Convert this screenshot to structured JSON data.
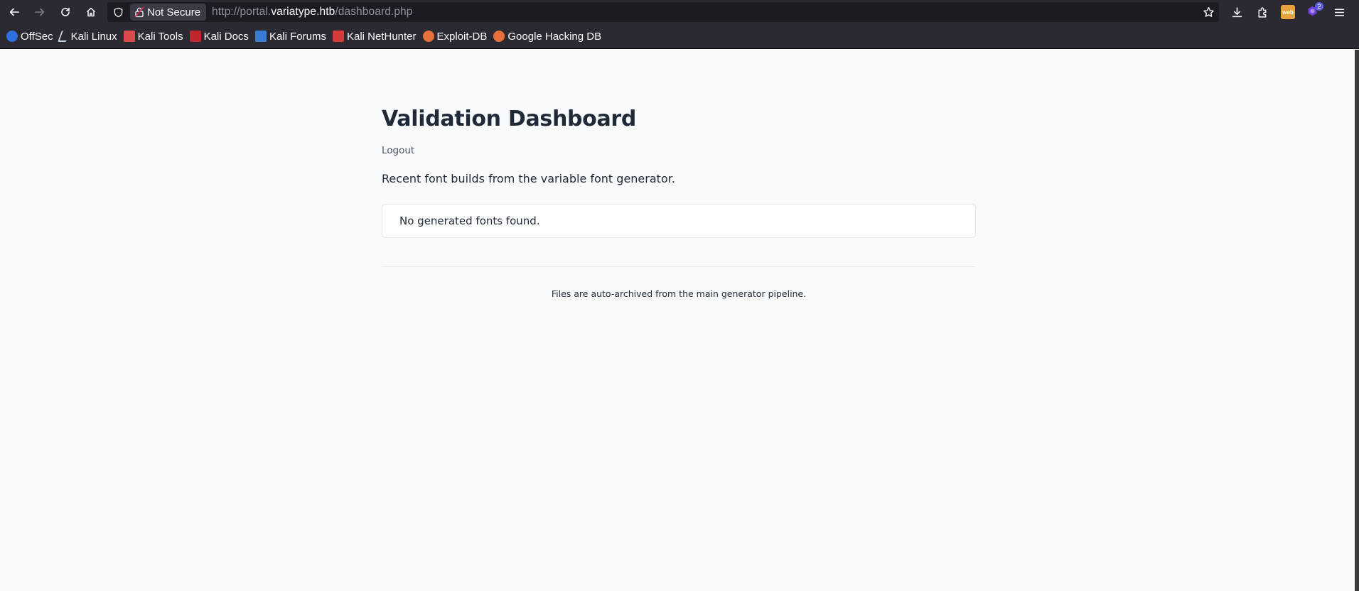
{
  "browser": {
    "security_label": "Not Secure",
    "url": {
      "prefix": "http://portal.",
      "host": "variatype.htb",
      "path": "/dashboard.php"
    },
    "extension_web_label": "web",
    "extension_badge": "2",
    "bookmarks": [
      {
        "label": "OffSec",
        "icon": "offsec-icon",
        "color": "#2f6fdf"
      },
      {
        "label": "Kali Linux",
        "icon": "kali-dragon-icon",
        "color": "#cfd6e6"
      },
      {
        "label": "Kali Tools",
        "icon": "kali-tools-icon",
        "color": "#d94a4a"
      },
      {
        "label": "Kali Docs",
        "icon": "kali-docs-icon",
        "color": "#c0262d"
      },
      {
        "label": "Kali Forums",
        "icon": "kali-forums-icon",
        "color": "#3a7bd5"
      },
      {
        "label": "Kali NetHunter",
        "icon": "nethunter-icon",
        "color": "#d63b3b"
      },
      {
        "label": "Exploit-DB",
        "icon": "exploit-db-icon",
        "color": "#e8703a"
      },
      {
        "label": "Google Hacking DB",
        "icon": "ghdb-icon",
        "color": "#e8703a"
      }
    ]
  },
  "main": {
    "title": "Validation Dashboard",
    "logout_label": "Logout",
    "subtitle": "Recent font builds from the variable font generator.",
    "empty_message": "No generated fonts found.",
    "footer_note": "Files are auto-archived from the main generator pipeline."
  }
}
